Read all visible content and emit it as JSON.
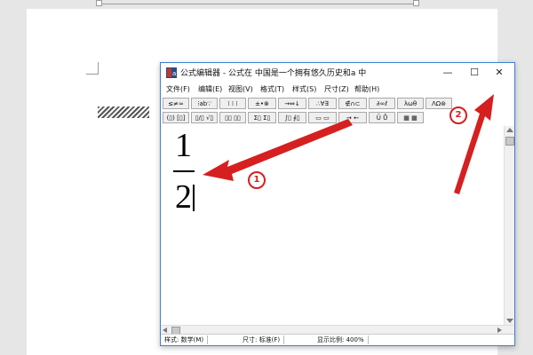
{
  "window": {
    "title": "公式编辑器 - 公式在 中国是一个拥有悠久历史和a 中",
    "minimize_glyph": "—",
    "maximize_glyph": "☐",
    "close_glyph": "✕"
  },
  "menu": [
    "文件(F)",
    "编辑(E)",
    "视图(V)",
    "格式(T)",
    "样式(S)",
    "尺寸(Z)",
    "帮助(H)"
  ],
  "toolbar_row1": [
    "≤≠≈",
    "⁝ab∵",
    "⁞ ⁞ ⁞",
    "±•⊗",
    "→⇔↓",
    "∴∀∃",
    "∉∩⊂",
    "∂∞ℓ",
    "λωθ",
    "ΛΩ⊛"
  ],
  "toolbar_row2": [
    "(▯) [▯]",
    "▯/▯ √▯",
    "▯▯ ▯▯",
    "Σ▯ Σ▯",
    "∫▯ ∮▯",
    "▭ ▭",
    "→ ←",
    "Ū Ů",
    "▦ ▦"
  ],
  "equation": {
    "numerator": "1",
    "denominator": "2"
  },
  "status": {
    "style": "样式: 数学(M)",
    "size": "尺寸: 标准(F)",
    "zoom": "显示比例: 400%"
  },
  "annotations": [
    "1",
    "2"
  ],
  "colors": {
    "annotation_red": "#d61f1f",
    "window_border": "#3c7fd6"
  }
}
